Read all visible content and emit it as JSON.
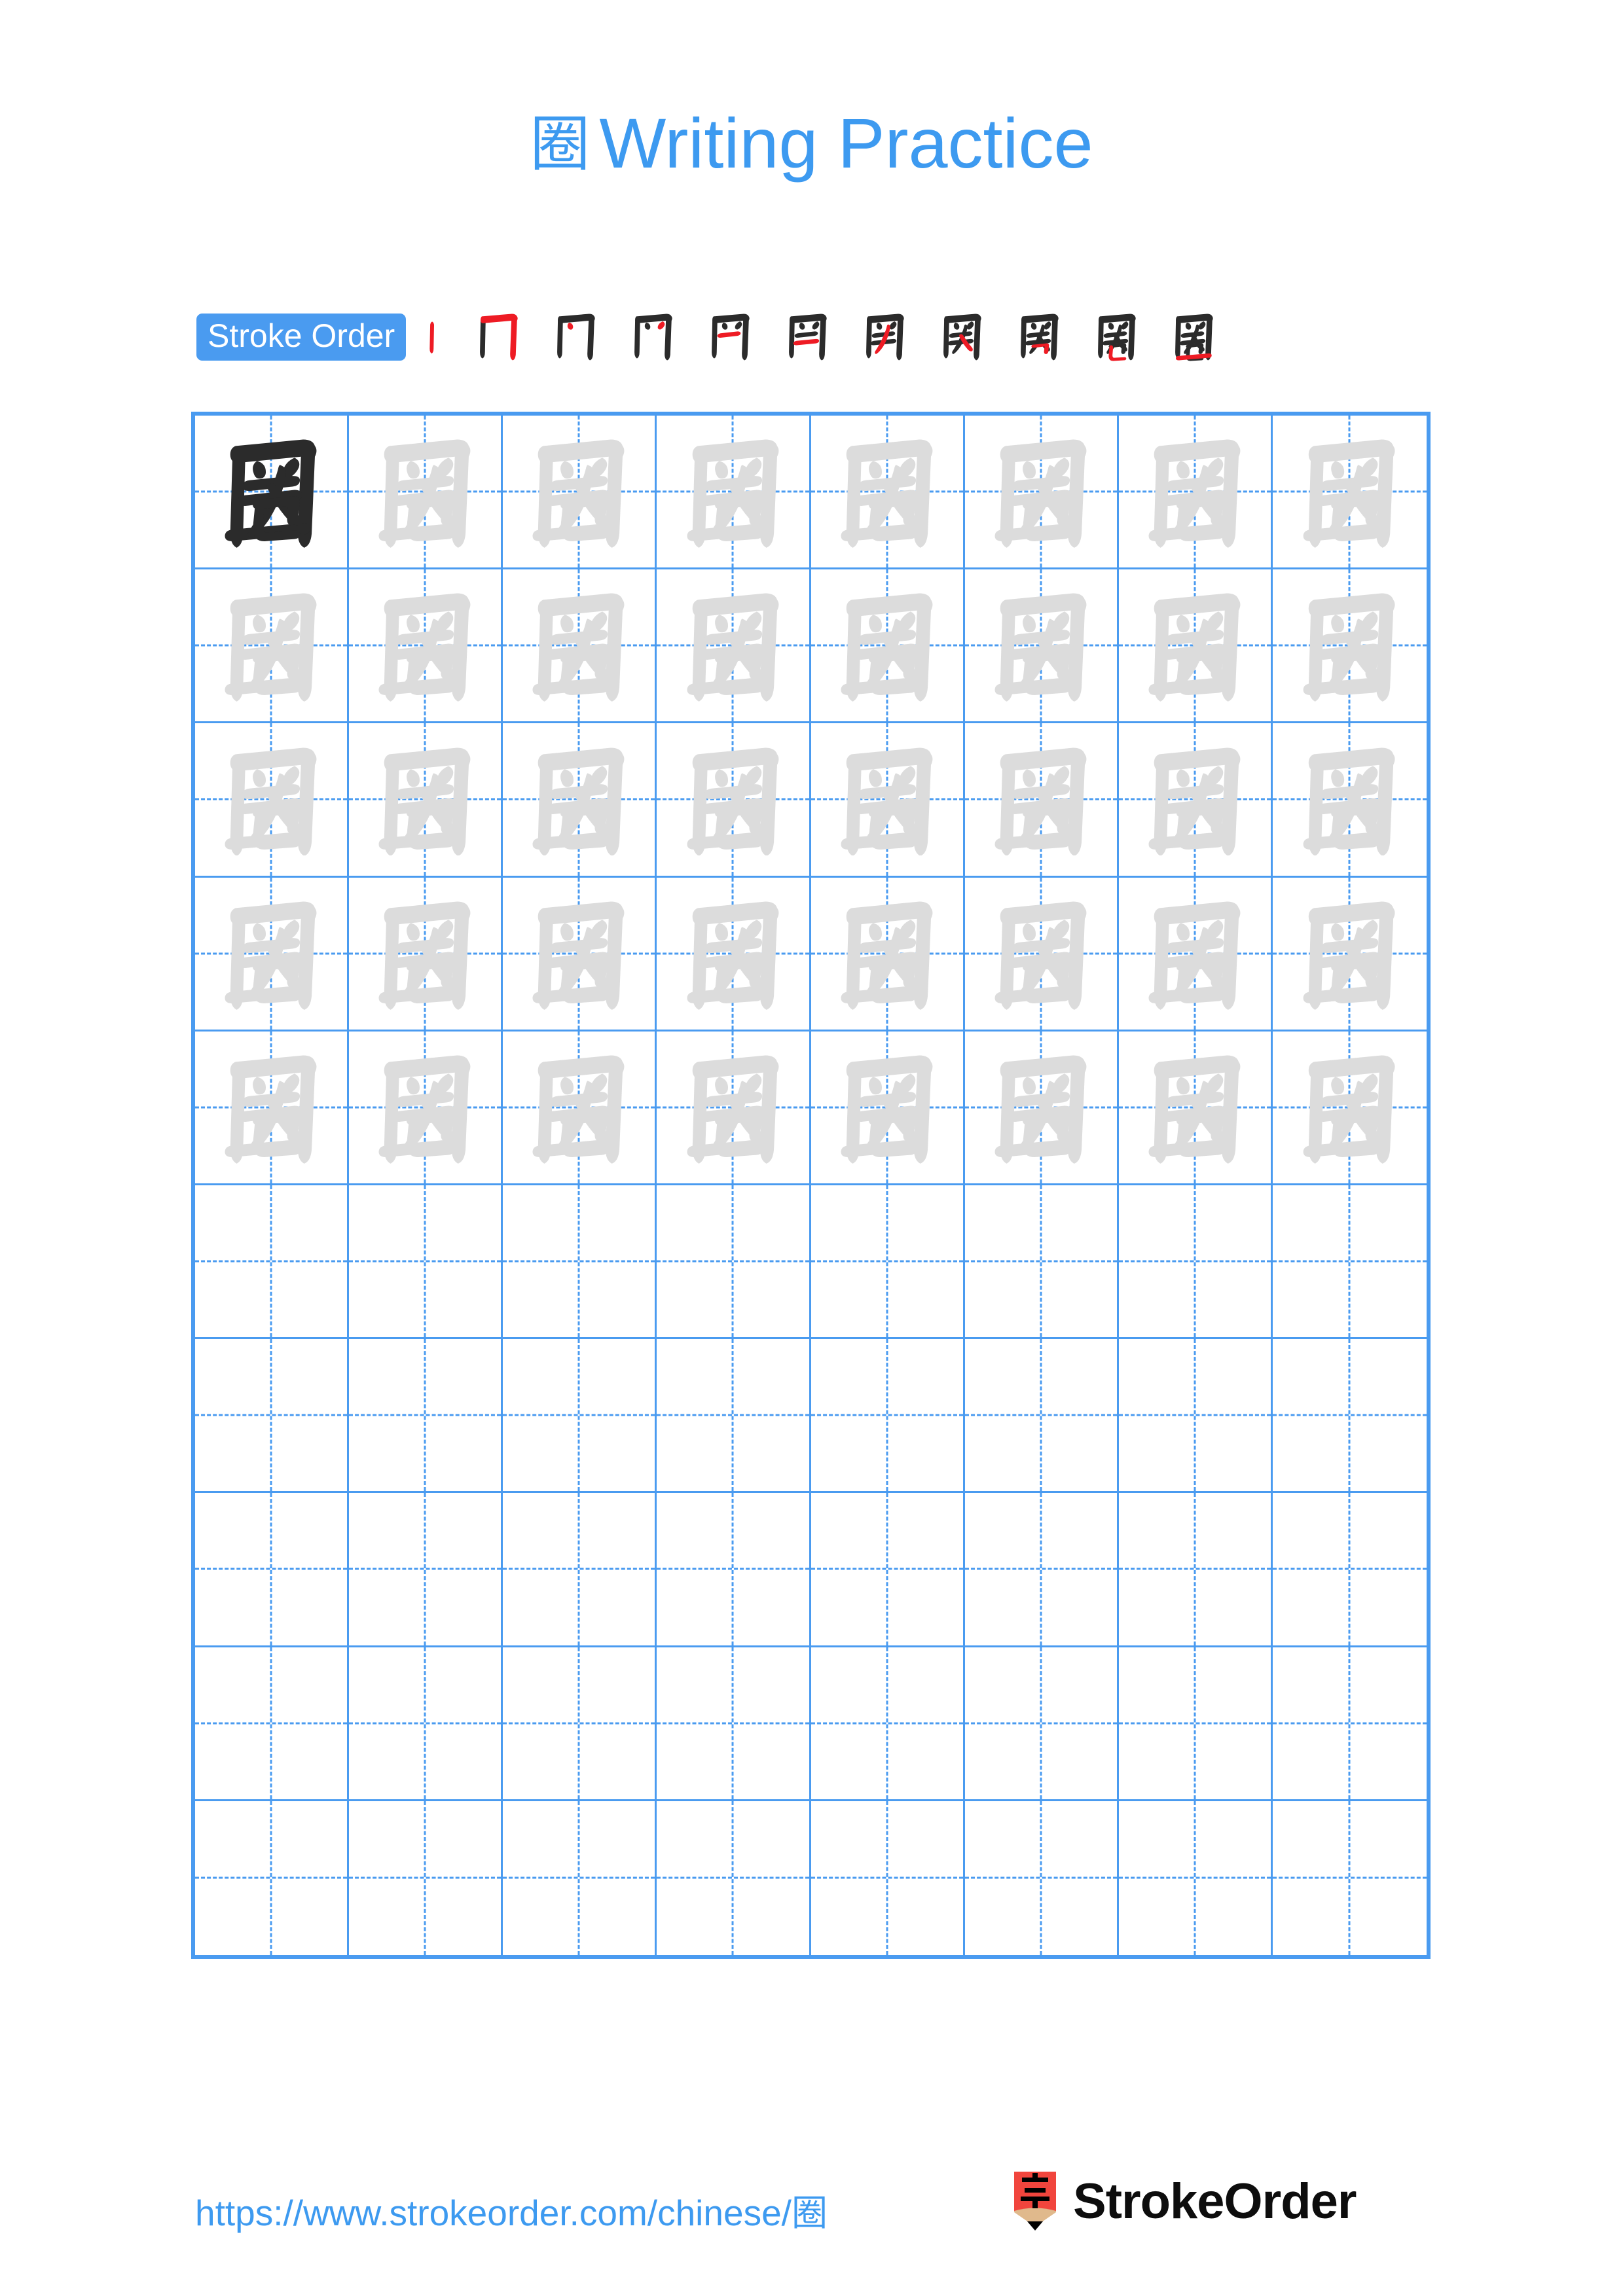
{
  "document": {
    "character": "圈",
    "title_suffix": "Writing Practice",
    "background_color": "#ffffff",
    "accent_blue": "#4A9BF0",
    "title_blue": "#3D9AF0",
    "guide_gray": "#DCDCDC",
    "ink_black": "#2B2B2B",
    "stroke_highlight_red": "#EE1B24"
  },
  "header": {
    "title_character": "圈",
    "title_text": "Writing Practice"
  },
  "stroke_order": {
    "badge_label": "Stroke Order",
    "total_strokes": 11,
    "steps": [
      {
        "index": 1,
        "strokes_shown": 1,
        "new_stroke": "shu (vertical)"
      },
      {
        "index": 2,
        "strokes_shown": 2,
        "new_stroke": "heng-zhe-gou"
      },
      {
        "index": 3,
        "strokes_shown": 3,
        "new_stroke": "dian"
      },
      {
        "index": 4,
        "strokes_shown": 4,
        "new_stroke": "dian"
      },
      {
        "index": 5,
        "strokes_shown": 5,
        "new_stroke": "heng"
      },
      {
        "index": 6,
        "strokes_shown": 6,
        "new_stroke": "heng"
      },
      {
        "index": 7,
        "strokes_shown": 7,
        "new_stroke": "pie"
      },
      {
        "index": 8,
        "strokes_shown": 8,
        "new_stroke": "na"
      },
      {
        "index": 9,
        "strokes_shown": 9,
        "new_stroke": "heng-zhe"
      },
      {
        "index": 10,
        "strokes_shown": 10,
        "new_stroke": "shu-wan"
      },
      {
        "index": 11,
        "strokes_shown": 11,
        "new_stroke": "heng (closing base)"
      }
    ]
  },
  "practice_grid": {
    "columns": 8,
    "rows": 10,
    "rows_with_characters": 5,
    "empty_rows": 5,
    "model_cell": {
      "row": 1,
      "column": 1,
      "style": "dark-ink"
    },
    "trace_cell_style": "light-gray",
    "guide_lines": "dashed-cross",
    "cells": [
      [
        "dark",
        "trace",
        "trace",
        "trace",
        "trace",
        "trace",
        "trace",
        "trace"
      ],
      [
        "trace",
        "trace",
        "trace",
        "trace",
        "trace",
        "trace",
        "trace",
        "trace"
      ],
      [
        "trace",
        "trace",
        "trace",
        "trace",
        "trace",
        "trace",
        "trace",
        "trace"
      ],
      [
        "trace",
        "trace",
        "trace",
        "trace",
        "trace",
        "trace",
        "trace",
        "trace"
      ],
      [
        "trace",
        "trace",
        "trace",
        "trace",
        "trace",
        "trace",
        "trace",
        "trace"
      ],
      [
        "empty",
        "empty",
        "empty",
        "empty",
        "empty",
        "empty",
        "empty",
        "empty"
      ],
      [
        "empty",
        "empty",
        "empty",
        "empty",
        "empty",
        "empty",
        "empty",
        "empty"
      ],
      [
        "empty",
        "empty",
        "empty",
        "empty",
        "empty",
        "empty",
        "empty",
        "empty"
      ],
      [
        "empty",
        "empty",
        "empty",
        "empty",
        "empty",
        "empty",
        "empty",
        "empty"
      ],
      [
        "empty",
        "empty",
        "empty",
        "empty",
        "empty",
        "empty",
        "empty",
        "empty"
      ]
    ]
  },
  "footer": {
    "url": "https://www.strokeorder.com/chinese/圈",
    "brand_name": "StrokeOrder",
    "logo_character": "字",
    "logo_body_color": "#F1453D",
    "logo_wood_color": "#E0B98C",
    "logo_tip_color": "#000000"
  }
}
